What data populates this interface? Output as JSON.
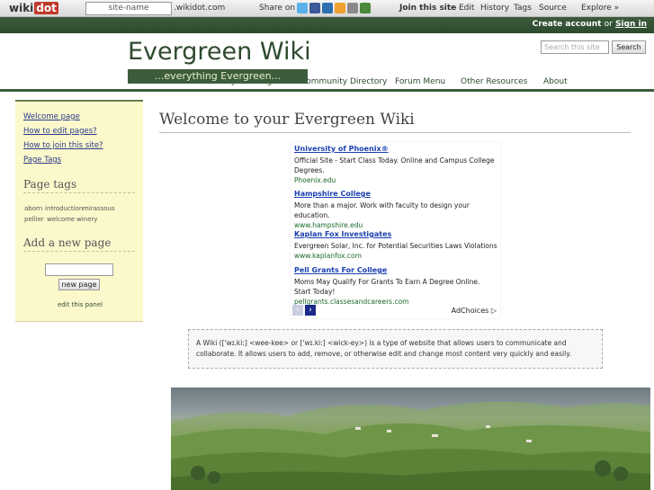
{
  "topbar": {
    "logo_main": "wiki",
    "logo_dot": "dot",
    "site_name_input": "site-name",
    "site_name_suffix": ".wikidot.com",
    "share_label": "Share on",
    "join": "Join this site",
    "edit": "Edit",
    "history": "History",
    "tags": "Tags",
    "source": "Source",
    "explore": "Explore »"
  },
  "accountbar": {
    "create_account": "Create account",
    "or": "or",
    "sign_in": "Sign in"
  },
  "header": {
    "site_title": "Evergreen Wiki",
    "subtitle": "...everything Evergreen...",
    "search_placeholder": "Search this site",
    "search_button": "Search"
  },
  "nav": {
    "items": [
      "History of Evergreen",
      "Community Directory",
      "Forum Menu",
      "Other Resources",
      "About"
    ]
  },
  "sidebar": {
    "links": [
      "Welcome page",
      "How to edit pages?",
      "How to join this site?",
      "Page Tags"
    ],
    "tags_heading": "Page tags",
    "tags": [
      "aborn",
      "introduction",
      "mirassous",
      "pellier",
      "welcome",
      "winery"
    ],
    "new_page_heading": "Add a new page",
    "new_page_button": "new page",
    "edit_panel": "edit this panel"
  },
  "main": {
    "page_title": "Welcome to your Evergreen Wiki",
    "wiki_box_text": "A Wiki (['wɪ.ki:] <wee-kee> or ['wɪ.ki:] <wick-ey>) is a type of website that allows users to communicate and collaborate. It allows users to add, remove, or otherwise edit and change most content very quickly and easily."
  },
  "ads": {
    "items": [
      {
        "title": "University of Phoenix®",
        "body": "Official Site - Start Class Today. Online and Campus College Degrees.",
        "url": "Phoenix.edu"
      },
      {
        "title": "Hampshire College",
        "body": "More than a major. Work with faculty to design your education.",
        "url": "www.hampshire.edu"
      },
      {
        "title": "Kaplan Fox Investigates",
        "body": "Evergreen Solar, Inc. for Potential Securities Laws Violations",
        "url": "www.kaplanfox.com"
      },
      {
        "title": "Pell Grants For College",
        "body": "Moms May Qualify For Grants To Earn A Degree Online. Start Today!",
        "url": "pellgrants.classesandcareers.com"
      }
    ],
    "prev": "‹",
    "next": "›",
    "adchoices": "AdChoices ▷"
  },
  "colors": {
    "brand_green": "#3c5c3c",
    "sidebar_bg": "#fbf8cc",
    "link_blue": "#2a3a8a"
  }
}
